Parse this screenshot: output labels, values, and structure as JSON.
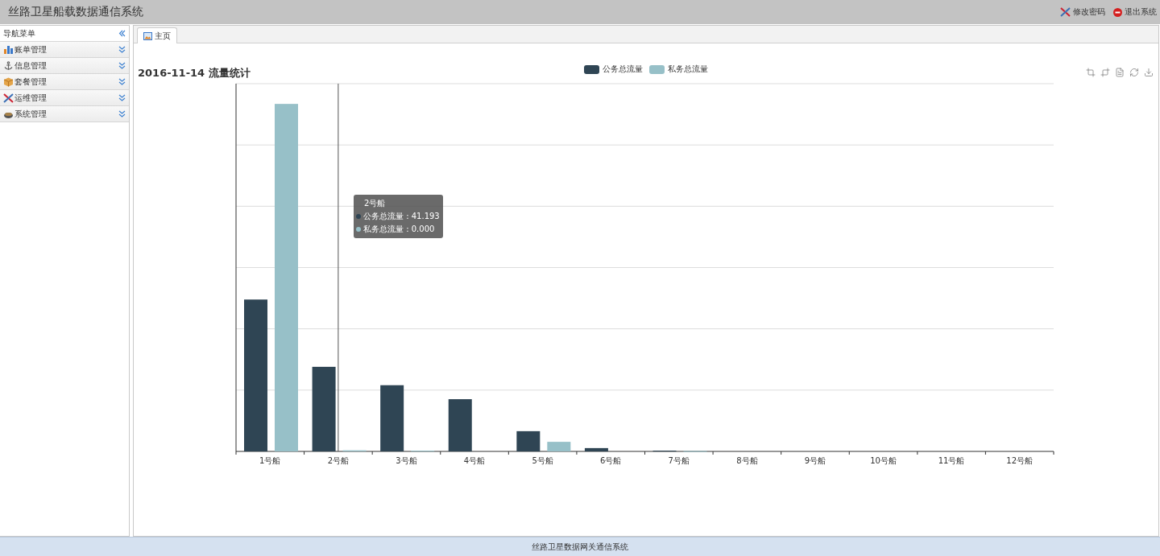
{
  "window": {
    "title": "丝路卫星船载数据通信系统"
  },
  "header_links": [
    {
      "kind": "password",
      "label": "修改密码"
    },
    {
      "kind": "logout",
      "label": "退出系统"
    }
  ],
  "sidebar": {
    "title": "导航菜单",
    "items": [
      {
        "kind": "bill",
        "label": "账单管理",
        "expanded": false
      },
      {
        "kind": "info",
        "label": "信息管理",
        "expanded": false
      },
      {
        "kind": "package",
        "label": "套餐管理",
        "expanded": false
      },
      {
        "kind": "ops",
        "label": "运维管理",
        "expanded": false
      },
      {
        "kind": "system",
        "label": "系统管理",
        "expanded": false
      }
    ]
  },
  "tabs": [
    {
      "label": "主页",
      "selected": true
    }
  ],
  "chart": {
    "title": "2016-11-14 流量统计",
    "legend": [
      {
        "label": "公务总流量",
        "color": "#2f4554"
      },
      {
        "label": "私务总流量",
        "color": "#97c0c8"
      }
    ],
    "categories": [
      "1号船",
      "2号船",
      "3号船",
      "4号船",
      "5号船",
      "6号船",
      "7号船",
      "8号船",
      "9号船",
      "10号船",
      "11号船",
      "12号船"
    ],
    "tooltip": {
      "title": "2号船",
      "rows": [
        {
          "color": "#2f4554",
          "text": "公务总流量 : 41.193"
        },
        {
          "color": "#97c0c8",
          "text": "私务总流量 : 0.000"
        }
      ]
    }
  },
  "status_bar": "丝路卫星数据网关通信系统"
}
